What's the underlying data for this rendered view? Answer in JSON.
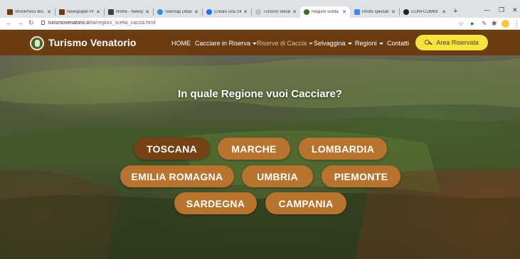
{
  "browser": {
    "tabs": [
      {
        "label": "WordPress Blo",
        "favicon_color": "#6b3b12"
      },
      {
        "label": "Newspaper Pr",
        "favicon_color": "#6b3b12"
      },
      {
        "label": "Home - Newsp",
        "favicon_color": "#3c4043"
      },
      {
        "label": "Sitemap Detai",
        "favicon_color": "#2d8cf0"
      },
      {
        "label": "Creare una Sit",
        "favicon_color": "#1a73e8"
      },
      {
        "label": "Turismo Venat",
        "favicon_color": "#bdc1c6"
      },
      {
        "label": "Regioni scelta",
        "favicon_color": "#3e6b2a"
      },
      {
        "label": "Photo speciali",
        "favicon_color": "#4285f4"
      },
      {
        "label": "CONFCOMMI",
        "favicon_color": "#202124"
      }
    ],
    "new_tab": "+",
    "url_host": "turismovenatorio.it",
    "url_path": "/ita/regioni_scelta_caccia.html"
  },
  "site": {
    "brand": "Turismo Venatorio",
    "nav": {
      "home": "HOME",
      "cacciare_in_riserva": "Cacciare in Riserva",
      "riserve_di_caccia": "Riserve di Caccia",
      "selvaggina": "Selvaggina",
      "regioni": "Regioni",
      "contatti": "Contatti"
    },
    "area_button": "Area Riservata",
    "question": "In quale Regione vuoi Cacciare?",
    "regions": [
      "TOSCANA",
      "MARCHE",
      "LOMBARDIA",
      "EMILIA ROMAGNA",
      "UMBRIA",
      "PIEMONTE",
      "SARDEGNA",
      "CAMPANIA"
    ],
    "active_region": "TOSCANA"
  },
  "colors": {
    "header_bg": "#6b3b12",
    "region_button": "#b8742e",
    "region_button_active": "#744214",
    "area_button": "#f5e33f"
  }
}
